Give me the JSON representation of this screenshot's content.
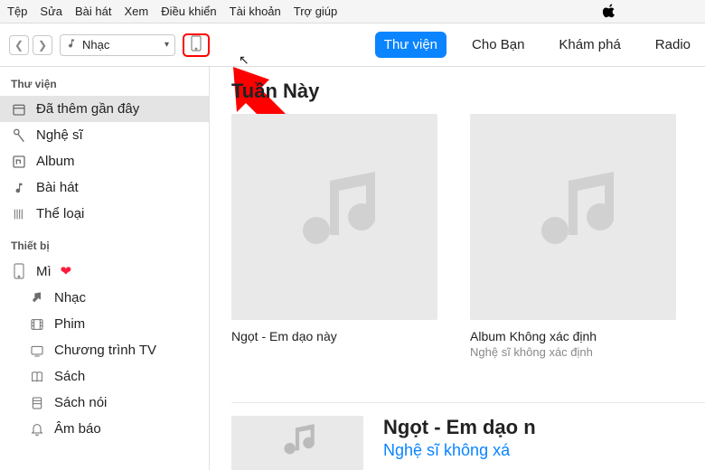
{
  "menu": {
    "items": [
      "Tệp",
      "Sửa",
      "Bài hát",
      "Xem",
      "Điều khiển",
      "Tài khoản",
      "Trợ giúp"
    ]
  },
  "toolbar": {
    "dropdown_label": "Nhạc",
    "tabs": {
      "library": "Thư viện",
      "for_you": "Cho Bạn",
      "browse": "Khám phá",
      "radio": "Radio"
    }
  },
  "sidebar": {
    "section1": "Thư viện",
    "items1": [
      {
        "label": "Đã thêm gần đây"
      },
      {
        "label": "Nghệ sĩ"
      },
      {
        "label": "Album"
      },
      {
        "label": "Bài hát"
      },
      {
        "label": "Thể loại"
      }
    ],
    "section2": "Thiết bị",
    "device": {
      "label": "Mì"
    },
    "items2": [
      {
        "label": "Nhạc"
      },
      {
        "label": "Phim"
      },
      {
        "label": "Chương trình TV"
      },
      {
        "label": "Sách"
      },
      {
        "label": "Sách nói"
      },
      {
        "label": "Âm báo"
      }
    ]
  },
  "main": {
    "section_title": "Tuần Này",
    "albums": [
      {
        "title": "Ngọt - Em dạo này",
        "sub": ""
      },
      {
        "title": "Album Không xác định",
        "sub": "Nghệ sĩ không xác định"
      }
    ],
    "detail": {
      "title": "Ngọt - Em dạo n",
      "sub": "Nghệ sĩ không xá"
    }
  }
}
